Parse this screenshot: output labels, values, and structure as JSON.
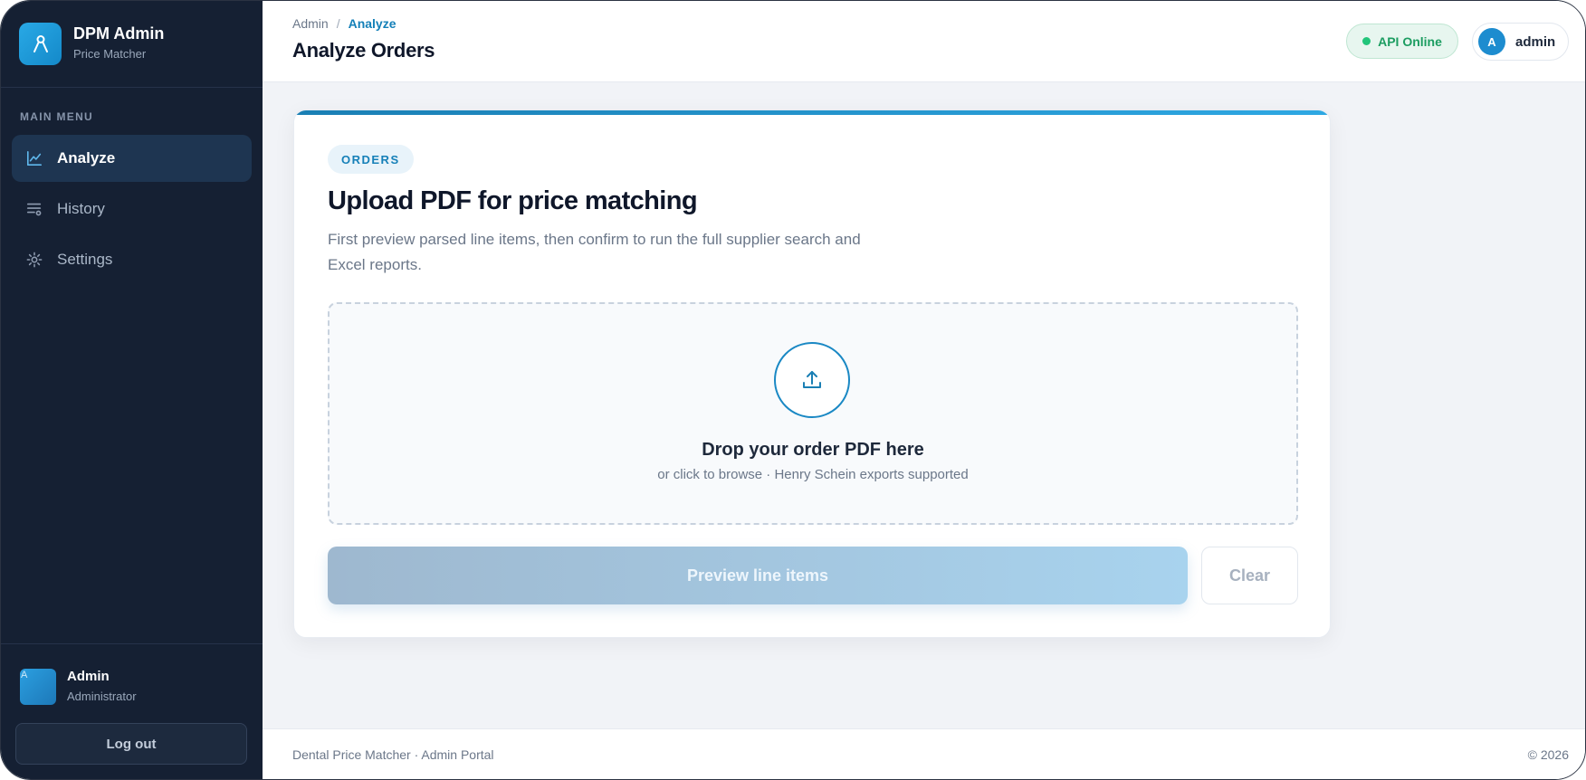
{
  "sidebar": {
    "brand_title": "DPM Admin",
    "brand_subtitle": "Price Matcher",
    "menu_label": "MAIN MENU",
    "items": [
      {
        "label": "Analyze",
        "icon": "chart-line-icon",
        "active": true
      },
      {
        "label": "History",
        "icon": "list-icon",
        "active": false
      },
      {
        "label": "Settings",
        "icon": "gear-icon",
        "active": false
      }
    ],
    "user": {
      "avatar_letter": "A",
      "name": "Admin",
      "role": "Administrator"
    },
    "logout_label": "Log out"
  },
  "header": {
    "breadcrumb_root": "Admin",
    "breadcrumb_sep": "/",
    "breadcrumb_current": "Analyze",
    "title": "Analyze Orders",
    "status_text": "API Online",
    "user_letter": "A",
    "user_name": "admin"
  },
  "card": {
    "tag": "ORDERS",
    "title": "Upload PDF for price matching",
    "description": "First preview parsed line items, then confirm to run the full supplier search and Excel reports.",
    "dropzone_title": "Drop your order PDF here",
    "dropzone_subtitle": "or click to browse · Henry Schein exports supported",
    "preview_label": "Preview line items",
    "clear_label": "Clear"
  },
  "footer": {
    "left": "Dental Price Matcher · Admin Portal",
    "right": "© 2026"
  },
  "colors": {
    "sidebar_bg": "#152033",
    "accent": "#1480b8",
    "status_green": "#22c57a"
  }
}
